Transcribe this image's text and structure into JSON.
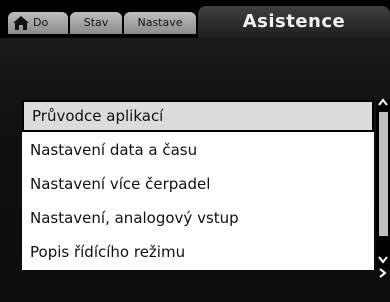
{
  "tabs": [
    {
      "label": "Do",
      "icon": "home-icon"
    },
    {
      "label": "Stav"
    },
    {
      "label": "Nastave"
    }
  ],
  "active_tab": {
    "label": "Asistence"
  },
  "menu": {
    "items": [
      {
        "label": "Průvodce aplikací",
        "selected": true
      },
      {
        "label": "Nastavení data a času"
      },
      {
        "label": "Nastavení více čerpadel"
      },
      {
        "label": "Nastavení, analogový vstup"
      },
      {
        "label": "Popis řídícího režimu"
      }
    ]
  },
  "scrollbar": {
    "up_icon": "chevron-up-icon",
    "down_icon": "chevron-down-icon",
    "more_icon": "chevron-right-icon"
  }
}
